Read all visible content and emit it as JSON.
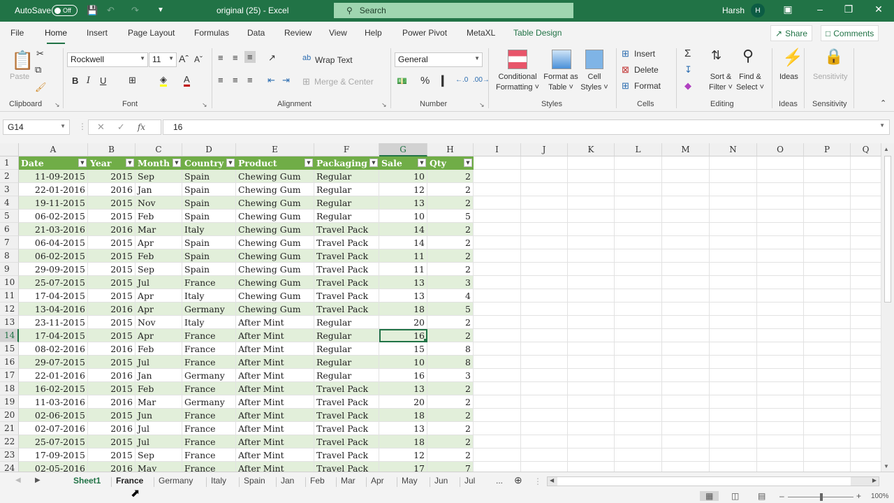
{
  "titlebar": {
    "autosave_label": "AutoSave",
    "autosave_state": "Off",
    "doc_title": "original (25)  -  Excel",
    "search_placeholder": "Search",
    "user_name": "Harsh",
    "user_initial": "H"
  },
  "ribbon_tabs": [
    "File",
    "Home",
    "Insert",
    "Page Layout",
    "Formulas",
    "Data",
    "Review",
    "View",
    "Help",
    "Power Pivot",
    "MetaXL",
    "Table Design"
  ],
  "active_tab": "Home",
  "share_label": "Share",
  "comments_label": "Comments",
  "ribbon": {
    "clipboard": {
      "paste": "Paste",
      "label": "Clipboard"
    },
    "font": {
      "name": "Rockwell",
      "size": "11",
      "label": "Font",
      "bold": "B",
      "italic": "I",
      "underline": "U",
      "colors": {
        "highlight": "#ffff00",
        "font": "#c00000"
      }
    },
    "alignment": {
      "wrap_text": "Wrap Text",
      "merge_center": "Merge & Center",
      "label": "Alignment"
    },
    "number": {
      "format": "General",
      "label": "Number"
    },
    "styles": {
      "conditional_1": "Conditional",
      "conditional_2": "Formatting",
      "format_table_1": "Format as",
      "format_table_2": "Table",
      "cell_styles_1": "Cell",
      "cell_styles_2": "Styles",
      "label": "Styles"
    },
    "cells": {
      "insert": "Insert",
      "delete": "Delete",
      "format": "Format",
      "label": "Cells"
    },
    "editing": {
      "sort_1": "Sort &",
      "sort_2": "Filter",
      "find_1": "Find &",
      "find_2": "Select",
      "label": "Editing"
    },
    "ideas": {
      "button": "Ideas",
      "label": "Ideas"
    },
    "sensitivity": {
      "button": "Sensitivity",
      "label": "Sensitivity"
    }
  },
  "formula_bar": {
    "name_box": "G14",
    "formula": "16"
  },
  "columns": [
    "A",
    "B",
    "C",
    "D",
    "E",
    "F",
    "G",
    "H",
    "I",
    "J",
    "K",
    "L",
    "M",
    "N",
    "O",
    "P",
    "Q"
  ],
  "selected_column": "G",
  "selected_row": 14,
  "table": {
    "headers": [
      "Date",
      "Year",
      "Month",
      "Country",
      "Product",
      "Packaging",
      "Sale",
      "Qty"
    ],
    "rows": [
      [
        "11-09-2015",
        "2015",
        "Sep",
        "Spain",
        "Chewing Gum",
        "Regular",
        "10",
        "2"
      ],
      [
        "22-01-2016",
        "2016",
        "Jan",
        "Spain",
        "Chewing Gum",
        "Regular",
        "12",
        "2"
      ],
      [
        "19-11-2015",
        "2015",
        "Nov",
        "Spain",
        "Chewing Gum",
        "Regular",
        "13",
        "2"
      ],
      [
        "06-02-2015",
        "2015",
        "Feb",
        "Spain",
        "Chewing Gum",
        "Regular",
        "10",
        "5"
      ],
      [
        "21-03-2016",
        "2016",
        "Mar",
        "Italy",
        "Chewing Gum",
        "Travel Pack",
        "14",
        "2"
      ],
      [
        "06-04-2015",
        "2015",
        "Apr",
        "Spain",
        "Chewing Gum",
        "Travel Pack",
        "14",
        "2"
      ],
      [
        "06-02-2015",
        "2015",
        "Feb",
        "Spain",
        "Chewing Gum",
        "Travel Pack",
        "11",
        "2"
      ],
      [
        "29-09-2015",
        "2015",
        "Sep",
        "Spain",
        "Chewing Gum",
        "Travel Pack",
        "11",
        "2"
      ],
      [
        "25-07-2015",
        "2015",
        "Jul",
        "France",
        "Chewing Gum",
        "Travel Pack",
        "13",
        "3"
      ],
      [
        "17-04-2015",
        "2015",
        "Apr",
        "Italy",
        "Chewing Gum",
        "Travel Pack",
        "13",
        "4"
      ],
      [
        "13-04-2016",
        "2016",
        "Apr",
        "Germany",
        "Chewing Gum",
        "Travel Pack",
        "18",
        "5"
      ],
      [
        "23-11-2015",
        "2015",
        "Nov",
        "Italy",
        "After Mint",
        "Regular",
        "20",
        "2"
      ],
      [
        "17-04-2015",
        "2015",
        "Apr",
        "France",
        "After Mint",
        "Regular",
        "16",
        "2"
      ],
      [
        "08-02-2016",
        "2016",
        "Feb",
        "France",
        "After Mint",
        "Regular",
        "15",
        "8"
      ],
      [
        "29-07-2015",
        "2015",
        "Jul",
        "France",
        "After Mint",
        "Regular",
        "10",
        "8"
      ],
      [
        "22-01-2016",
        "2016",
        "Jan",
        "Germany",
        "After Mint",
        "Regular",
        "16",
        "3"
      ],
      [
        "16-02-2015",
        "2015",
        "Feb",
        "France",
        "After Mint",
        "Travel Pack",
        "13",
        "2"
      ],
      [
        "11-03-2016",
        "2016",
        "Mar",
        "Germany",
        "After Mint",
        "Travel Pack",
        "20",
        "2"
      ],
      [
        "02-06-2015",
        "2015",
        "Jun",
        "France",
        "After Mint",
        "Travel Pack",
        "18",
        "2"
      ],
      [
        "02-07-2016",
        "2016",
        "Jul",
        "France",
        "After Mint",
        "Travel Pack",
        "13",
        "2"
      ],
      [
        "25-07-2015",
        "2015",
        "Jul",
        "France",
        "After Mint",
        "Travel Pack",
        "18",
        "2"
      ],
      [
        "17-09-2015",
        "2015",
        "Sep",
        "France",
        "After Mint",
        "Travel Pack",
        "12",
        "2"
      ],
      [
        "02-05-2016",
        "2016",
        "May",
        "France",
        "After Mint",
        "Travel Pack",
        "17",
        "7"
      ]
    ]
  },
  "sheet_tabs": [
    "Sheet1",
    "France",
    "Germany",
    "Italy",
    "Spain",
    "Jan",
    "Feb",
    "Mar",
    "Apr",
    "May",
    "Jun",
    "Jul"
  ],
  "active_sheet": "Sheet1",
  "more_sheets": "...",
  "status": {
    "zoom": "100%"
  },
  "colors": {
    "excel_green": "#217346",
    "table_header": "#70ad47",
    "table_band": "#e2efda"
  }
}
